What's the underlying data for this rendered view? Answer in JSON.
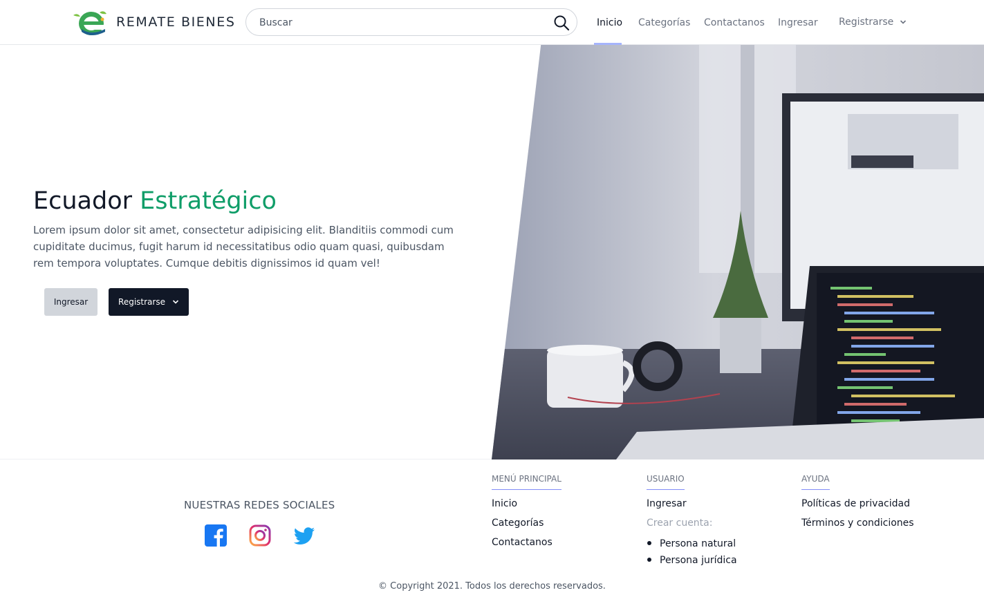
{
  "header": {
    "brand": "REMATE BIENES",
    "search_placeholder": "Buscar",
    "nav": {
      "inicio": "Inicio",
      "categorias": "Categorías",
      "contactanos": "Contactanos",
      "ingresar": "Ingresar",
      "registrarse": "Registrarse"
    }
  },
  "hero": {
    "title_main": "Ecuador",
    "title_accent": "Estratégico",
    "text": "Lorem ipsum dolor sit amet, consectetur adipisicing elit. Blanditiis commodi cum cupiditate ducimus, fugit harum id necessitatibus odio quam quasi, quibusdam rem tempora voluptates. Cumque debitis dignissimos id quam vel!",
    "btn_ingresar": "Ingresar",
    "btn_registrarse": "Registrarse"
  },
  "footer": {
    "social_title": "NUESTRAS REDES SOCIALES",
    "menu": {
      "title": "MENÚ PRINCIPAL",
      "inicio": "Inicio",
      "categorias": "Categorías",
      "contactanos": "Contactanos"
    },
    "usuario": {
      "title": "USUARIO",
      "ingresar": "Ingresar",
      "crear_label": "Crear cuenta:",
      "natural": "Persona natural",
      "juridica": "Persona jurídica"
    },
    "ayuda": {
      "title": "AYUDA",
      "privacidad": "Políticas de privacidad",
      "terminos": "Términos y condiciones"
    },
    "copyright": "© Copyright 2021. Todos los derechos reservados."
  },
  "colors": {
    "accent_green": "#0f9d68",
    "dark_button": "#111827",
    "nav_underline": "#a5b4fc"
  },
  "icons": {
    "search": "search-icon",
    "chevron": "chevron-down-icon",
    "facebook": "facebook-icon",
    "instagram": "instagram-icon",
    "twitter": "twitter-icon"
  }
}
